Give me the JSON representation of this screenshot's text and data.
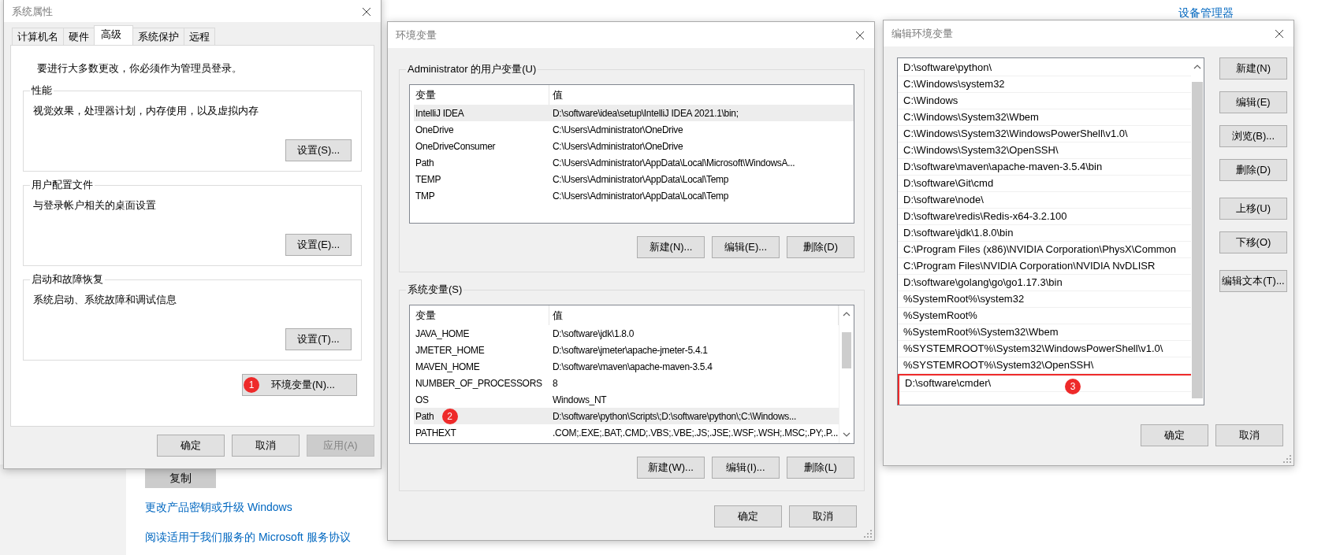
{
  "background_page": {
    "top_link": "设备管理器",
    "copy_button": "复制",
    "links": [
      "更改产品密钥或升级 Windows",
      "阅读适用于我们服务的 Microsoft 服务协议"
    ]
  },
  "system_properties": {
    "title": "系统属性",
    "tabs": [
      {
        "label": "计算机名",
        "selected": false
      },
      {
        "label": "硬件",
        "selected": false
      },
      {
        "label": "高级",
        "selected": true
      },
      {
        "label": "系统保护",
        "selected": false
      },
      {
        "label": "远程",
        "selected": false
      }
    ],
    "notice": "要进行大多数更改，你必须作为管理员登录。",
    "groups": [
      {
        "title": "性能",
        "description": "视觉效果，处理器计划，内存使用，以及虚拟内存",
        "button": "设置(S)..."
      },
      {
        "title": "用户配置文件",
        "description": "与登录帐户相关的桌面设置",
        "button": "设置(E)..."
      },
      {
        "title": "启动和故障恢复",
        "description": "系统启动、系统故障和调试信息",
        "button": "设置(T)..."
      }
    ],
    "env_button": {
      "label": "环境变量(N)...",
      "marker": "1"
    },
    "buttons": [
      {
        "label": "确定",
        "disabled": false
      },
      {
        "label": "取消",
        "disabled": false
      },
      {
        "label": "应用(A)",
        "disabled": true
      }
    ]
  },
  "environment_variables": {
    "title": "环境变量",
    "user_group": {
      "title": "Administrator 的用户变量(U)",
      "columns": [
        "变量",
        "值"
      ],
      "rows": [
        {
          "name": "IntelliJ IDEA",
          "value": "D:\\software\\idea\\setup\\IntelliJ IDEA 2021.1\\bin;",
          "selected": true
        },
        {
          "name": "OneDrive",
          "value": "C:\\Users\\Administrator\\OneDrive",
          "selected": false
        },
        {
          "name": "OneDriveConsumer",
          "value": "C:\\Users\\Administrator\\OneDrive",
          "selected": false
        },
        {
          "name": "Path",
          "value": "C:\\Users\\Administrator\\AppData\\Local\\Microsoft\\WindowsA...",
          "selected": false
        },
        {
          "name": "TEMP",
          "value": "C:\\Users\\Administrator\\AppData\\Local\\Temp",
          "selected": false
        },
        {
          "name": "TMP",
          "value": "C:\\Users\\Administrator\\AppData\\Local\\Temp",
          "selected": false
        }
      ],
      "buttons": [
        "新建(N)...",
        "编辑(E)...",
        "删除(D)"
      ]
    },
    "system_group": {
      "title": "系统变量(S)",
      "columns": [
        "变量",
        "值"
      ],
      "rows": [
        {
          "name": "JAVA_HOME",
          "value": "D:\\software\\jdk\\1.8.0",
          "selected": false
        },
        {
          "name": "JMETER_HOME",
          "value": "D:\\software\\jmeter\\apache-jmeter-5.4.1",
          "selected": false
        },
        {
          "name": "MAVEN_HOME",
          "value": "D:\\software\\maven\\apache-maven-3.5.4",
          "selected": false
        },
        {
          "name": "NUMBER_OF_PROCESSORS",
          "value": "8",
          "selected": false
        },
        {
          "name": "OS",
          "value": "Windows_NT",
          "selected": false
        },
        {
          "name": "Path",
          "value": "D:\\software\\python\\Scripts\\;D:\\software\\python\\;C:\\Windows...",
          "selected": true,
          "marker": "2"
        },
        {
          "name": "PATHEXT",
          "value": ".COM;.EXE;.BAT;.CMD;.VBS;.VBE;.JS;.JSE;.WSF;.WSH;.MSC;.PY;.P...",
          "selected": false
        }
      ],
      "buttons": [
        "新建(W)...",
        "编辑(I)...",
        "删除(L)"
      ]
    },
    "buttons": [
      "确定",
      "取消"
    ]
  },
  "edit_variable": {
    "title": "编辑环境变量",
    "entries": [
      {
        "text": "D:\\software\\python\\",
        "annotated": false
      },
      {
        "text": "C:\\Windows\\system32",
        "annotated": false
      },
      {
        "text": "C:\\Windows",
        "annotated": false
      },
      {
        "text": "C:\\Windows\\System32\\Wbem",
        "annotated": false
      },
      {
        "text": "C:\\Windows\\System32\\WindowsPowerShell\\v1.0\\",
        "annotated": false
      },
      {
        "text": "C:\\Windows\\System32\\OpenSSH\\",
        "annotated": false
      },
      {
        "text": "D:\\software\\maven\\apache-maven-3.5.4\\bin",
        "annotated": false
      },
      {
        "text": "D:\\software\\Git\\cmd",
        "annotated": false
      },
      {
        "text": "D:\\software\\node\\",
        "annotated": false
      },
      {
        "text": "D:\\software\\redis\\Redis-x64-3.2.100",
        "annotated": false
      },
      {
        "text": "D:\\software\\jdk\\1.8.0\\bin",
        "annotated": false
      },
      {
        "text": "C:\\Program Files (x86)\\NVIDIA Corporation\\PhysX\\Common",
        "annotated": false
      },
      {
        "text": "C:\\Program Files\\NVIDIA Corporation\\NVIDIA NvDLISR",
        "annotated": false
      },
      {
        "text": "D:\\software\\golang\\go\\go1.17.3\\bin",
        "annotated": false
      },
      {
        "text": "%SystemRoot%\\system32",
        "annotated": false
      },
      {
        "text": "%SystemRoot%",
        "annotated": false
      },
      {
        "text": "%SystemRoot%\\System32\\Wbem",
        "annotated": false
      },
      {
        "text": "%SYSTEMROOT%\\System32\\WindowsPowerShell\\v1.0\\",
        "annotated": false
      },
      {
        "text": "%SYSTEMROOT%\\System32\\OpenSSH\\",
        "annotated": false
      },
      {
        "text": "D:\\software\\cmder\\",
        "annotated": true,
        "marker": "3"
      }
    ],
    "side_button_groups": [
      [
        "新建(N)",
        "编辑(E)",
        "浏览(B)...",
        "删除(D)"
      ],
      [
        "上移(U)",
        "下移(O)"
      ],
      [
        "编辑文本(T)..."
      ]
    ],
    "buttons": [
      "确定",
      "取消"
    ]
  }
}
